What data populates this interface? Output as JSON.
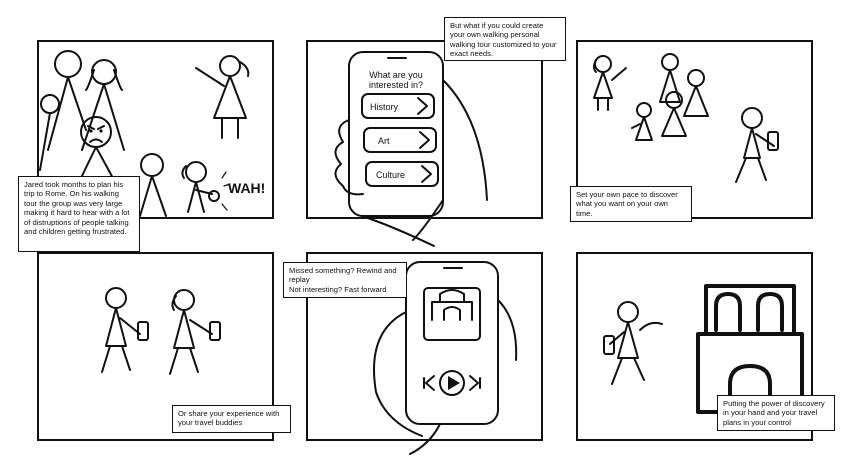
{
  "panels": [
    {
      "id": 1,
      "caption": "Jared took months to plan his trip to Rome. On his walking tour the group was very large making it hard to hear with a lot of distruptions of people talking and children getting frustrated.",
      "sound_effect": "WAH!"
    },
    {
      "id": 2,
      "caption": "But what if you could create your own walking personal walking tour customized to your exact needs.",
      "phone": {
        "title": "What are you interested in?",
        "options": [
          "History",
          "Art",
          "Culture"
        ]
      }
    },
    {
      "id": 3,
      "caption": "Set your own pace to discover what you want on your own time."
    },
    {
      "id": 4,
      "caption": "Or share your experience with your travel buddies"
    },
    {
      "id": 5,
      "caption": "Missed something? Rewind and replay\nNot interesting? Fast forward"
    },
    {
      "id": 6,
      "caption": "Putting the power of discovery in your hand and your travel plans in your control"
    }
  ],
  "icons": {
    "option_arrow": "chevron-right-icon",
    "play": "play-icon",
    "rewind": "rewind-icon",
    "fast_forward": "fast-forward-icon"
  }
}
